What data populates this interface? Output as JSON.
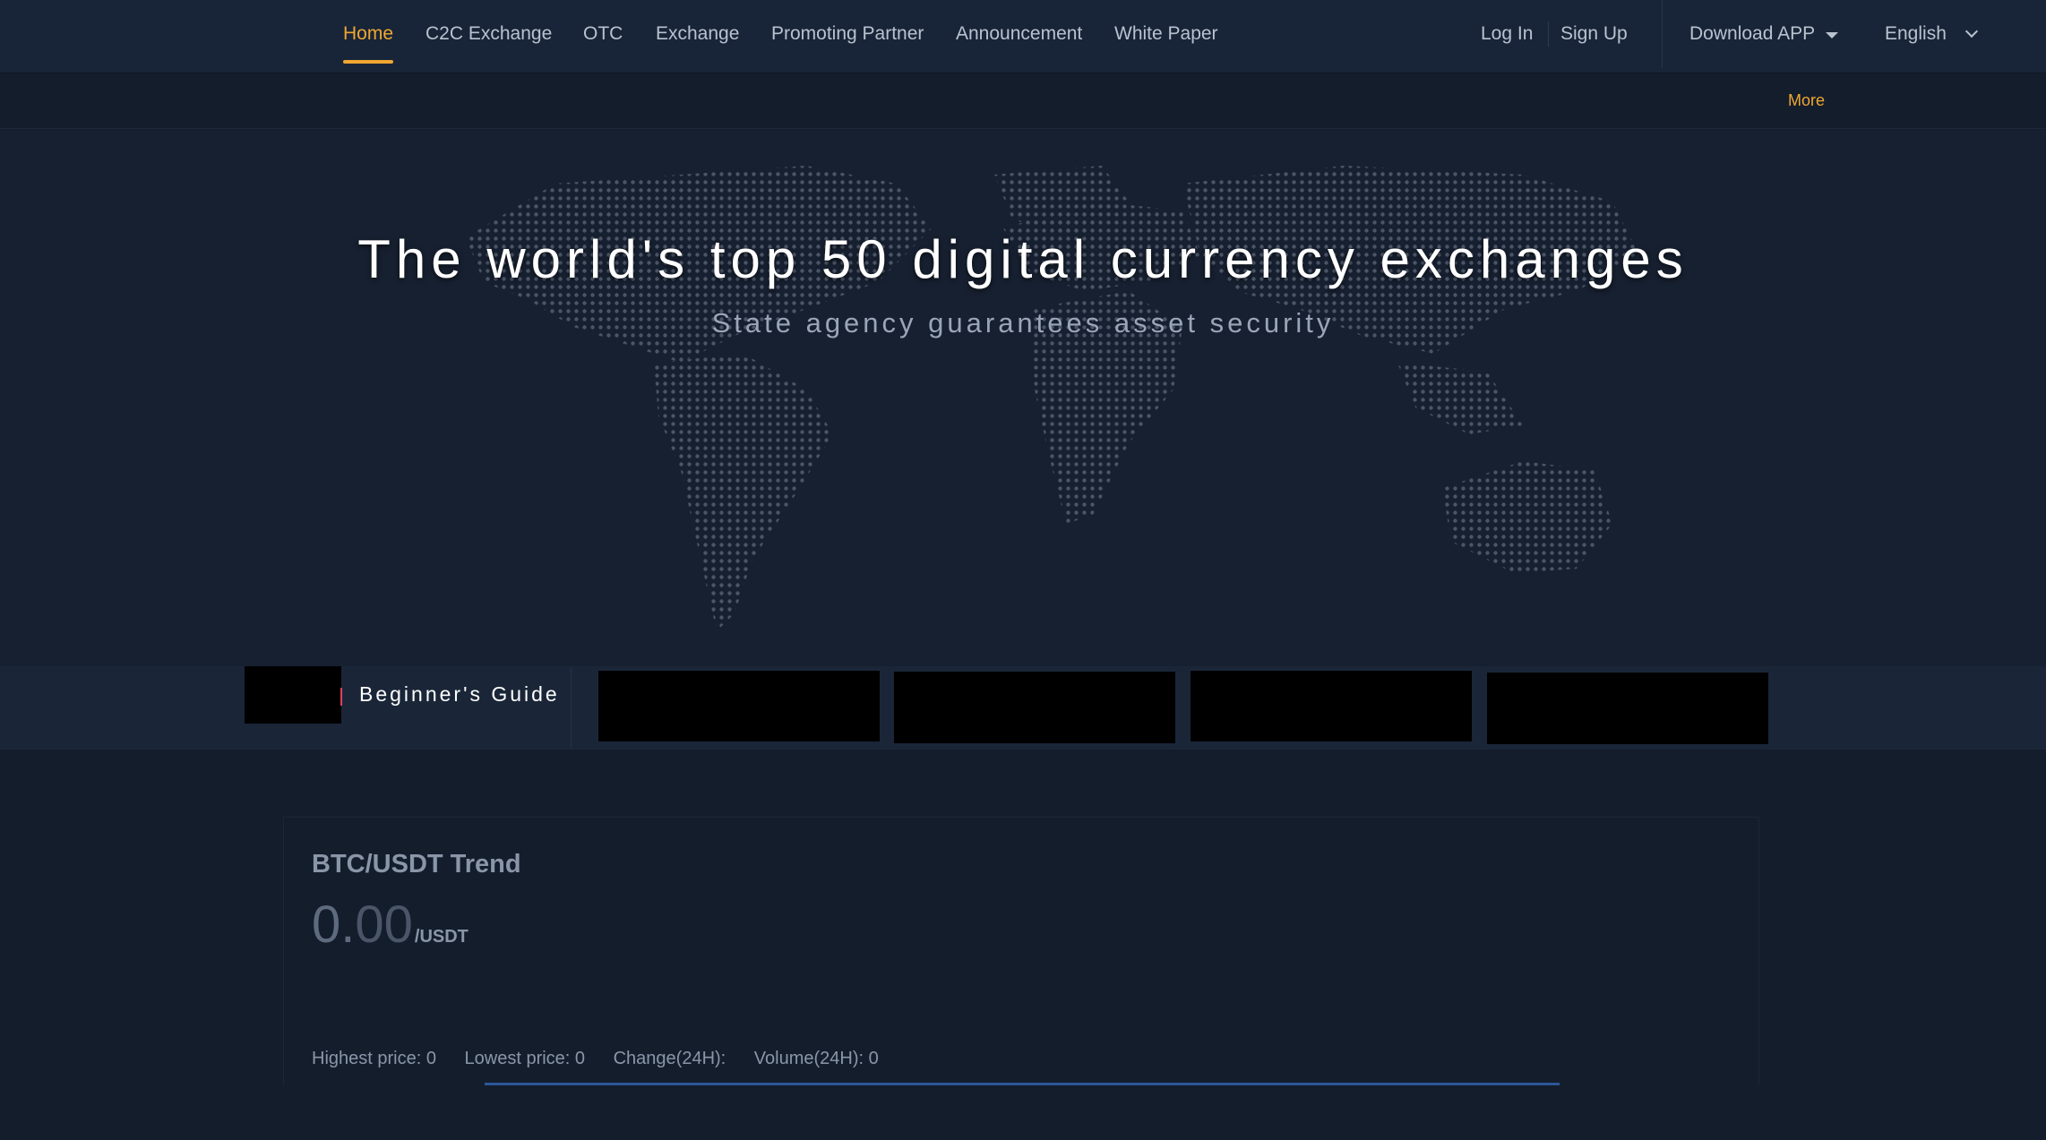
{
  "nav": {
    "items": [
      {
        "label": "Home",
        "active": true
      },
      {
        "label": "C2C Exchange"
      },
      {
        "label": "OTC"
      },
      {
        "label": "Exchange"
      },
      {
        "label": "Promoting Partner"
      },
      {
        "label": "Announcement"
      },
      {
        "label": "White Paper"
      }
    ],
    "login": "Log In",
    "signup": "Sign Up",
    "download": "Download APP",
    "language": "English",
    "accent_color": "#f0a731"
  },
  "notice": {
    "more": "More"
  },
  "hero": {
    "title": "The world's top 50 digital currency exchanges",
    "subtitle": "State agency guarantees asset security"
  },
  "guide": {
    "label": "Beginner's Guide"
  },
  "trend": {
    "title": "BTC/USDT Trend",
    "price_int": "0.",
    "price_dec": "00",
    "unit": "/USDT",
    "highest": "Highest price: 0",
    "lowest": "Lowest price: 0",
    "change": "Change(24H):",
    "volume": "Volume(24H): 0"
  }
}
